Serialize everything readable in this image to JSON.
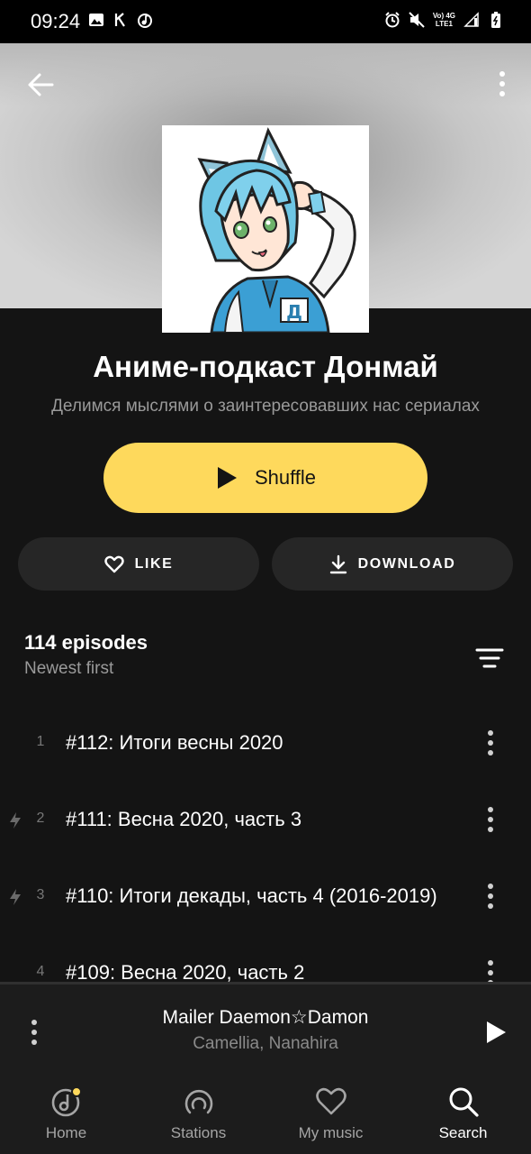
{
  "status_bar": {
    "time": "09:24",
    "left_icons": [
      "image-icon",
      "cast-icon",
      "music-note-icon"
    ],
    "right_icons": [
      "alarm-icon",
      "mute-icon",
      "network-volte-icon",
      "signal-icon",
      "battery-icon"
    ],
    "network_top": "Vo) 4G",
    "network_bottom": "LTE1"
  },
  "header": {
    "back_icon": "arrow-left-icon",
    "more_icon": "more-vertical-icon"
  },
  "podcast": {
    "title": "Аниме-подкаст Донмай",
    "subtitle": "Делимся мыслями о заинтересовавших нас сериалах",
    "cover_letter": "Д"
  },
  "actions": {
    "shuffle_label": "Shuffle",
    "like_label": "LIKE",
    "download_label": "DOWNLOAD",
    "accent": "#fed95c"
  },
  "episodes": {
    "count_label": "114 episodes",
    "sort_label": "Newest first",
    "items": [
      {
        "num": "1",
        "title": "#112: Итоги весны 2020",
        "flash": false
      },
      {
        "num": "2",
        "title": "#111: Весна 2020, часть 3",
        "flash": true
      },
      {
        "num": "3",
        "title": "#110: Итоги декады, часть 4 (2016-2019)",
        "flash": true
      },
      {
        "num": "4",
        "title": "#109: Весна 2020, часть 2",
        "flash": false
      }
    ]
  },
  "player": {
    "title": "Mailer Daemon☆Damon",
    "artist": "Camellia, Nanahira"
  },
  "nav": {
    "items": [
      {
        "label": "Home",
        "icon": "home-disc-icon",
        "active": false
      },
      {
        "label": "Stations",
        "icon": "radio-icon",
        "active": false
      },
      {
        "label": "My music",
        "icon": "heart-icon",
        "active": false
      },
      {
        "label": "Search",
        "icon": "search-icon",
        "active": true
      }
    ]
  }
}
